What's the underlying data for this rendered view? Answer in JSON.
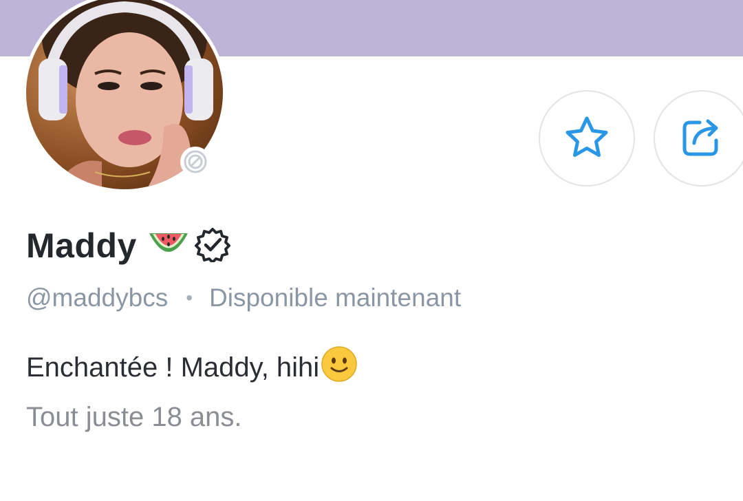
{
  "profile": {
    "display_name": "Maddy",
    "name_emoji": "watermelon-emoji",
    "verified_badge": "verified-badge-icon",
    "username": "@maddybcs",
    "availability": "Disponible maintenant",
    "separator": "•",
    "bio_line1": "Enchantée ! Maddy, hihi",
    "bio_emoji": "slightly-smiling-face-emoji",
    "bio_line2": "Tout juste 18 ans."
  },
  "actions": {
    "favorite_icon": "star-icon",
    "share_icon": "share-icon"
  },
  "colors": {
    "banner": "#bdb4d8",
    "accent": "#00aff0",
    "name_text": "#24272c",
    "muted_text": "#8a96a3"
  }
}
